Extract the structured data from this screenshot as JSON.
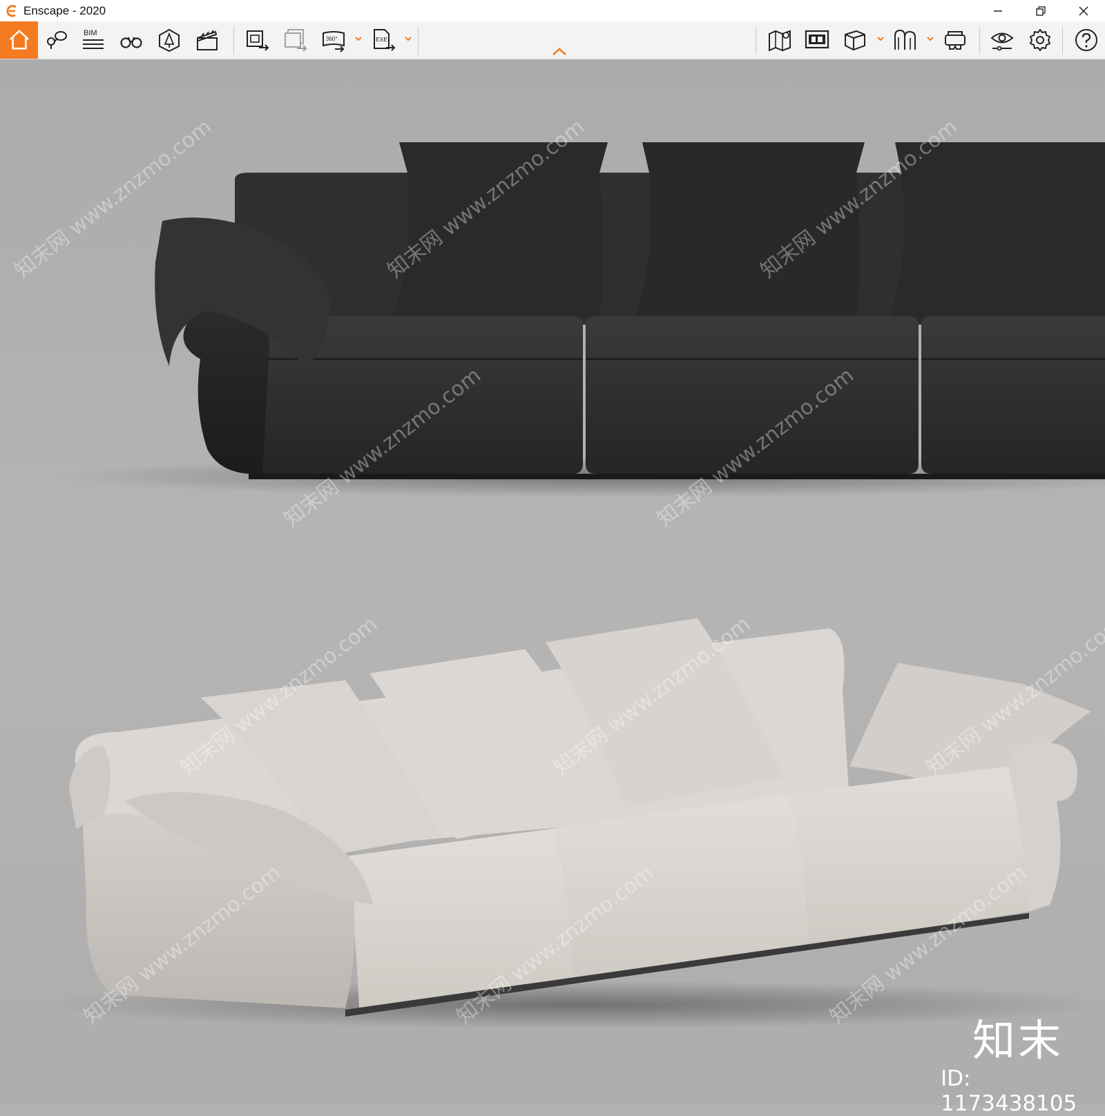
{
  "window": {
    "title": "Enscape - 2020",
    "accent": "#f47b20"
  },
  "toolbar": {
    "buttons": [
      {
        "name": "home",
        "icon": "home-icon"
      },
      {
        "name": "views",
        "icon": "location-pins-icon"
      },
      {
        "name": "bim",
        "icon": "bim-list-icon",
        "label": "BIM"
      },
      {
        "name": "asset-library",
        "icon": "binoculars-icon"
      },
      {
        "name": "assets",
        "icon": "cube-tree-icon"
      },
      {
        "name": "video-editor",
        "icon": "clapperboard-icon"
      },
      {
        "name": "screenshot",
        "icon": "export-image-icon"
      },
      {
        "name": "batch-render",
        "icon": "batch-export-icon"
      },
      {
        "name": "panorama",
        "icon": "panorama-export-icon",
        "label": "360°"
      },
      {
        "name": "exe-export",
        "icon": "exe-export-icon",
        "label": "EXE"
      },
      {
        "name": "map",
        "icon": "map-pin-icon"
      },
      {
        "name": "image-view",
        "icon": "image-view-icon"
      },
      {
        "name": "view-mode",
        "icon": "box-icon"
      },
      {
        "name": "walk-mode",
        "icon": "arches-icon"
      },
      {
        "name": "vr",
        "icon": "vr-headset-icon"
      },
      {
        "name": "visual-settings",
        "icon": "eye-icon"
      },
      {
        "name": "settings",
        "icon": "gear-icon"
      },
      {
        "name": "help",
        "icon": "help-icon"
      }
    ]
  },
  "viewport": {
    "watermark": "知末网 www.znzmo.com",
    "brand": "知末",
    "id_label": "ID: 1173438105"
  }
}
